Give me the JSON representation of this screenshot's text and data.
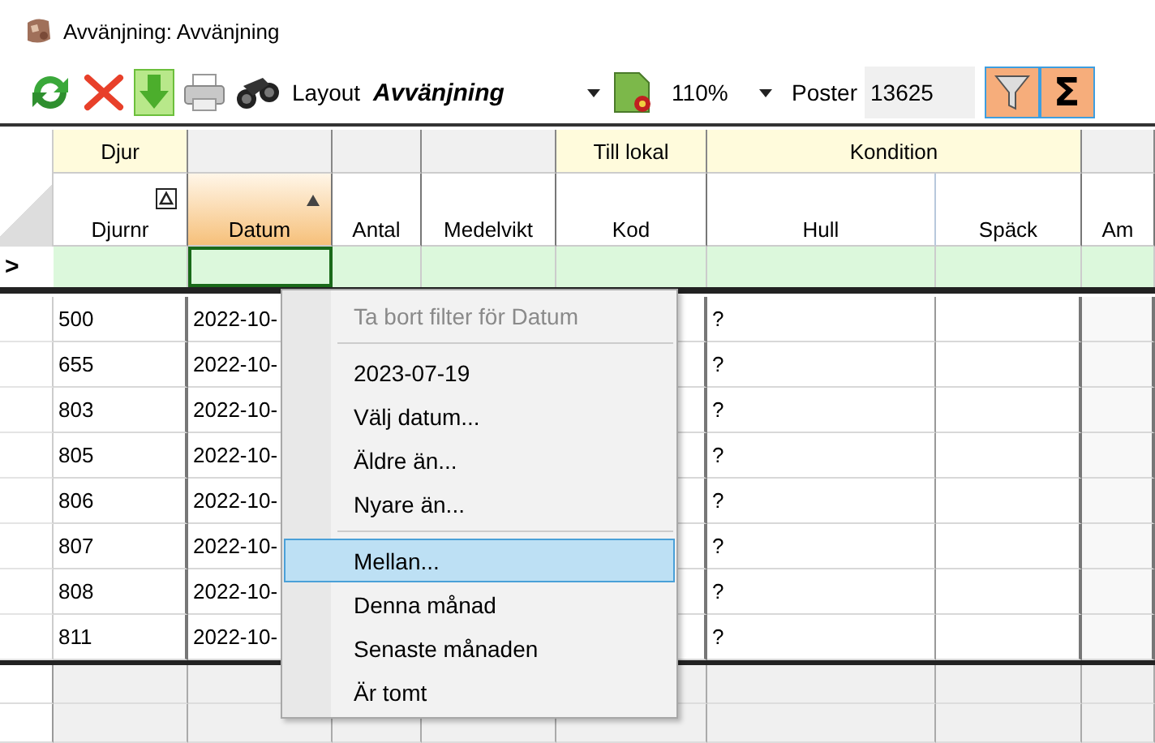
{
  "window": {
    "title": "Avvänjning: Avvänjning"
  },
  "toolbar": {
    "layout_label": "Layout",
    "layout_value": "Avvänjning",
    "zoom": "110%",
    "poster_label": "Poster",
    "poster_count": "13625",
    "filter_on": true,
    "sum_on": true,
    "sum_symbol": "Σ"
  },
  "grid": {
    "groups": [
      {
        "label": "Djur",
        "columns": [
          {
            "label": "Djurnr",
            "sorted": true,
            "selected": false
          }
        ]
      },
      {
        "columns": [
          {
            "label": "Datum",
            "sorted": true,
            "selected": true
          }
        ]
      },
      {
        "columns": [
          {
            "label": "Antal",
            "sorted": false,
            "selected": false
          }
        ]
      },
      {
        "columns": [
          {
            "label": "Medelvikt",
            "sorted": false,
            "selected": false
          }
        ]
      },
      {
        "label": "Till lokal",
        "columns": [
          {
            "label": "Kod",
            "sorted": false,
            "selected": false
          }
        ]
      },
      {
        "label": "Kondition",
        "columns": [
          {
            "label": "Hull",
            "sorted": false,
            "selected": false
          },
          {
            "label": "Späck",
            "sorted": false,
            "selected": false
          }
        ]
      },
      {
        "columns": [
          {
            "label": "Am",
            "sorted": false,
            "selected": false
          }
        ]
      }
    ],
    "filter_row": {
      "marker": ">"
    },
    "rows": [
      {
        "djurnr": "500",
        "datum": "2022-10-",
        "hull": "?"
      },
      {
        "djurnr": "655",
        "datum": "2022-10-",
        "hull": "?"
      },
      {
        "djurnr": "803",
        "datum": "2022-10-",
        "hull": "?"
      },
      {
        "djurnr": "805",
        "datum": "2022-10-",
        "hull": "?"
      },
      {
        "djurnr": "806",
        "datum": "2022-10-",
        "hull": "?"
      },
      {
        "djurnr": "807",
        "datum": "2022-10-",
        "hull": "?"
      },
      {
        "djurnr": "808",
        "datum": "2022-10-",
        "hull": "?"
      },
      {
        "djurnr": "811",
        "datum": "2022-10-",
        "hull": "?"
      }
    ]
  },
  "context_menu": {
    "items": [
      {
        "kind": "item",
        "label": "Ta bort filter för Datum",
        "disabled": true,
        "selected": false
      },
      {
        "kind": "separator"
      },
      {
        "kind": "item",
        "label": "2023-07-19",
        "disabled": false,
        "selected": false
      },
      {
        "kind": "item",
        "label": "Välj datum...",
        "disabled": false,
        "selected": false
      },
      {
        "kind": "item",
        "label": "Äldre än...",
        "disabled": false,
        "selected": false
      },
      {
        "kind": "item",
        "label": "Nyare än...",
        "disabled": false,
        "selected": false
      },
      {
        "kind": "separator"
      },
      {
        "kind": "item",
        "label": "Mellan...",
        "disabled": false,
        "selected": true
      },
      {
        "kind": "item",
        "label": "Denna månad",
        "disabled": false,
        "selected": false
      },
      {
        "kind": "item",
        "label": "Senaste månaden",
        "disabled": false,
        "selected": false
      },
      {
        "kind": "item",
        "label": "Är tomt",
        "disabled": false,
        "selected": false
      }
    ]
  }
}
